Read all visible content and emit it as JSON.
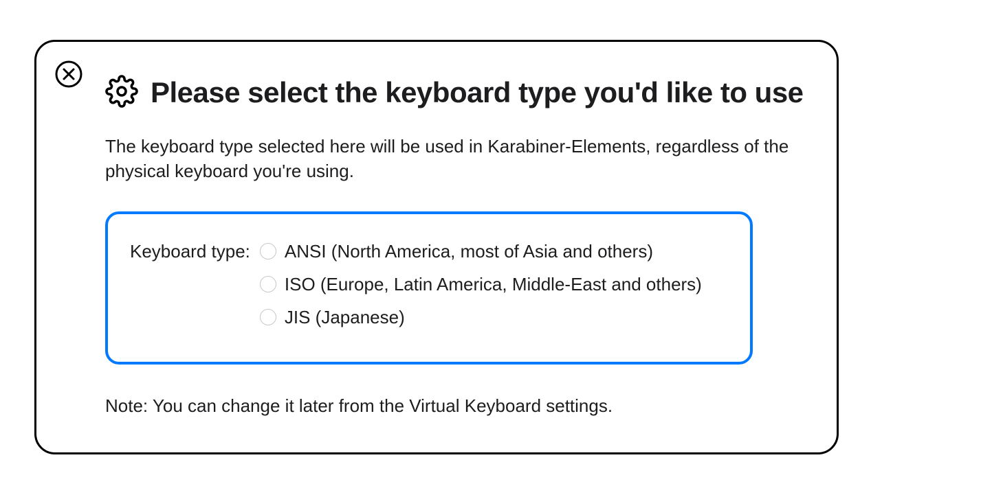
{
  "dialog": {
    "title": "Please select the keyboard type you'd like to use",
    "description": "The keyboard type selected here will be used in Karabiner-Elements, regardless of the physical keyboard you're using.",
    "form": {
      "label": "Keyboard type:",
      "options": [
        "ANSI (North America, most of Asia and others)",
        "ISO (Europe, Latin America, Middle-East and others)",
        "JIS (Japanese)"
      ]
    },
    "note": "Note: You can change it later from the Virtual Keyboard settings."
  }
}
